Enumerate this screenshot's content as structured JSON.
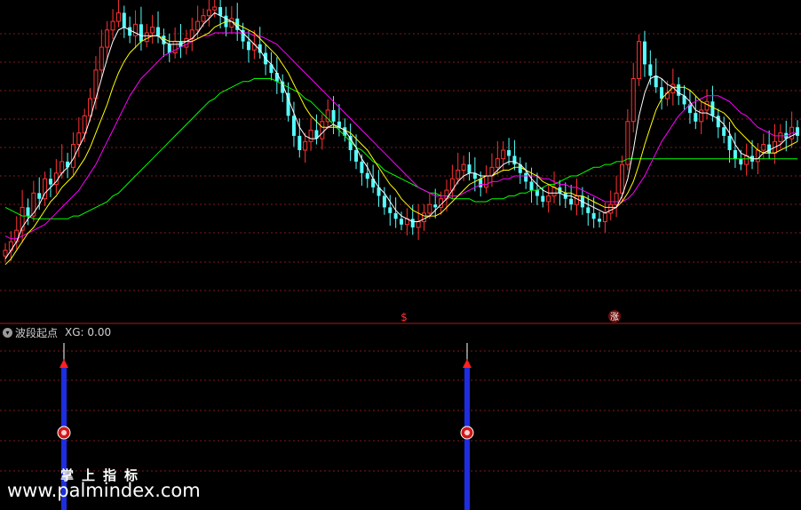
{
  "indicator": {
    "name": "波段起点",
    "value_label": "XG: 0.00",
    "toggle_icon": "chevron-down-icon"
  },
  "markers": {
    "sell_label": "$",
    "rise_label": "涨"
  },
  "watermark": {
    "chinese": "掌上指标",
    "url": "www.palmindex.com"
  },
  "colors": {
    "background": "#000000",
    "up_candle": "#ff3232",
    "down_candle": "#54ffff",
    "ma_fast": "#ffffff",
    "ma_mid": "#ffff00",
    "ma_slow": "#ff00ff",
    "ma_long": "#00ff00",
    "grid": "#7a1c1c",
    "divider": "#b01818",
    "signal_bar": "#1e2de0",
    "signal_arrow": "#ff2020"
  },
  "chart_data": {
    "type": "candlestick",
    "title": "",
    "xlabel": "",
    "ylabel": "",
    "series_main": {
      "close": [
        0.15,
        0.18,
        0.22,
        0.3,
        0.27,
        0.35,
        0.33,
        0.4,
        0.38,
        0.42,
        0.46,
        0.44,
        0.52,
        0.56,
        0.62,
        0.68,
        0.78,
        0.86,
        0.92,
        0.95,
        0.98,
        0.93,
        0.9,
        0.94,
        0.88,
        0.91,
        0.93,
        0.9,
        0.87,
        0.84,
        0.88,
        0.86,
        0.89,
        0.92,
        0.95,
        0.97,
        0.99,
        1.0,
        0.97,
        0.93,
        0.96,
        0.92,
        0.88,
        0.85,
        0.87,
        0.84,
        0.8,
        0.77,
        0.74,
        0.7,
        0.62,
        0.55,
        0.5,
        0.53,
        0.57,
        0.54,
        0.6,
        0.64,
        0.6,
        0.58,
        0.55,
        0.5,
        0.46,
        0.42,
        0.4,
        0.37,
        0.34,
        0.3,
        0.28,
        0.26,
        0.24,
        0.26,
        0.23,
        0.25,
        0.28,
        0.31,
        0.3,
        0.33,
        0.36,
        0.4,
        0.43,
        0.45,
        0.42,
        0.4,
        0.37,
        0.41,
        0.44,
        0.47,
        0.5,
        0.48,
        0.45,
        0.42,
        0.39,
        0.36,
        0.34,
        0.32,
        0.34,
        0.37,
        0.35,
        0.33,
        0.31,
        0.34,
        0.3,
        0.28,
        0.26,
        0.25,
        0.28,
        0.31,
        0.35,
        0.45,
        0.6,
        0.75,
        0.88,
        0.8,
        0.76,
        0.72,
        0.68,
        0.7,
        0.73,
        0.69,
        0.66,
        0.63,
        0.6,
        0.64,
        0.67,
        0.62,
        0.58,
        0.55,
        0.5,
        0.47,
        0.45,
        0.48,
        0.46,
        0.5,
        0.52,
        0.49,
        0.53,
        0.56,
        0.54,
        0.58,
        0.55
      ],
      "ma5": [
        0.12,
        0.15,
        0.18,
        0.23,
        0.26,
        0.28,
        0.31,
        0.35,
        0.37,
        0.39,
        0.42,
        0.44,
        0.47,
        0.51,
        0.55,
        0.61,
        0.68,
        0.75,
        0.82,
        0.88,
        0.92,
        0.93,
        0.92,
        0.91,
        0.9,
        0.9,
        0.9,
        0.9,
        0.88,
        0.87,
        0.87,
        0.87,
        0.88,
        0.89,
        0.91,
        0.94,
        0.96,
        0.98,
        0.97,
        0.96,
        0.95,
        0.93,
        0.91,
        0.89,
        0.87,
        0.85,
        0.82,
        0.8,
        0.77,
        0.73,
        0.68,
        0.63,
        0.58,
        0.55,
        0.54,
        0.54,
        0.56,
        0.58,
        0.59,
        0.58,
        0.57,
        0.54,
        0.51,
        0.47,
        0.44,
        0.4,
        0.37,
        0.35,
        0.32,
        0.29,
        0.27,
        0.26,
        0.25,
        0.25,
        0.26,
        0.27,
        0.29,
        0.31,
        0.33,
        0.36,
        0.39,
        0.41,
        0.42,
        0.42,
        0.41,
        0.41,
        0.41,
        0.43,
        0.45,
        0.46,
        0.46,
        0.45,
        0.43,
        0.4,
        0.38,
        0.36,
        0.35,
        0.35,
        0.35,
        0.34,
        0.34,
        0.33,
        0.32,
        0.31,
        0.3,
        0.29,
        0.28,
        0.29,
        0.3,
        0.34,
        0.4,
        0.5,
        0.62,
        0.7,
        0.75,
        0.76,
        0.75,
        0.73,
        0.72,
        0.7,
        0.69,
        0.67,
        0.64,
        0.63,
        0.63,
        0.62,
        0.61,
        0.59,
        0.56,
        0.52,
        0.49,
        0.48,
        0.47,
        0.47,
        0.49,
        0.5,
        0.51,
        0.52,
        0.54,
        0.55,
        0.56
      ],
      "ma10": [
        0.1,
        0.12,
        0.15,
        0.18,
        0.21,
        0.23,
        0.26,
        0.29,
        0.32,
        0.34,
        0.37,
        0.39,
        0.41,
        0.44,
        0.47,
        0.51,
        0.56,
        0.61,
        0.66,
        0.72,
        0.77,
        0.81,
        0.84,
        0.86,
        0.88,
        0.89,
        0.9,
        0.9,
        0.89,
        0.88,
        0.88,
        0.88,
        0.88,
        0.88,
        0.89,
        0.9,
        0.91,
        0.93,
        0.94,
        0.95,
        0.95,
        0.94,
        0.93,
        0.92,
        0.91,
        0.89,
        0.87,
        0.85,
        0.83,
        0.8,
        0.77,
        0.73,
        0.69,
        0.65,
        0.62,
        0.6,
        0.58,
        0.58,
        0.58,
        0.58,
        0.57,
        0.56,
        0.54,
        0.52,
        0.5,
        0.47,
        0.44,
        0.41,
        0.38,
        0.36,
        0.33,
        0.31,
        0.29,
        0.28,
        0.27,
        0.27,
        0.27,
        0.28,
        0.3,
        0.32,
        0.34,
        0.36,
        0.38,
        0.39,
        0.4,
        0.41,
        0.41,
        0.42,
        0.43,
        0.43,
        0.44,
        0.44,
        0.43,
        0.42,
        0.41,
        0.39,
        0.38,
        0.37,
        0.36,
        0.35,
        0.35,
        0.34,
        0.34,
        0.33,
        0.32,
        0.31,
        0.3,
        0.3,
        0.3,
        0.32,
        0.35,
        0.39,
        0.45,
        0.52,
        0.58,
        0.64,
        0.68,
        0.7,
        0.72,
        0.72,
        0.72,
        0.71,
        0.69,
        0.67,
        0.66,
        0.65,
        0.64,
        0.63,
        0.61,
        0.58,
        0.56,
        0.54,
        0.52,
        0.5,
        0.49,
        0.49,
        0.49,
        0.5,
        0.51,
        0.52,
        0.53
      ],
      "ma20": [
        0.2,
        0.19,
        0.19,
        0.2,
        0.21,
        0.22,
        0.23,
        0.24,
        0.26,
        0.28,
        0.3,
        0.32,
        0.34,
        0.36,
        0.39,
        0.42,
        0.45,
        0.49,
        0.53,
        0.57,
        0.61,
        0.65,
        0.69,
        0.72,
        0.75,
        0.77,
        0.79,
        0.81,
        0.83,
        0.84,
        0.85,
        0.86,
        0.87,
        0.88,
        0.89,
        0.9,
        0.9,
        0.91,
        0.91,
        0.91,
        0.91,
        0.91,
        0.91,
        0.91,
        0.9,
        0.9,
        0.89,
        0.88,
        0.87,
        0.85,
        0.83,
        0.81,
        0.79,
        0.77,
        0.75,
        0.73,
        0.71,
        0.69,
        0.67,
        0.65,
        0.63,
        0.61,
        0.59,
        0.57,
        0.55,
        0.53,
        0.51,
        0.49,
        0.47,
        0.45,
        0.43,
        0.41,
        0.39,
        0.37,
        0.36,
        0.35,
        0.34,
        0.34,
        0.34,
        0.34,
        0.34,
        0.35,
        0.36,
        0.37,
        0.38,
        0.38,
        0.39,
        0.39,
        0.4,
        0.4,
        0.41,
        0.41,
        0.41,
        0.41,
        0.41,
        0.4,
        0.4,
        0.39,
        0.38,
        0.38,
        0.37,
        0.37,
        0.36,
        0.35,
        0.34,
        0.33,
        0.32,
        0.32,
        0.32,
        0.32,
        0.33,
        0.35,
        0.38,
        0.41,
        0.45,
        0.49,
        0.53,
        0.56,
        0.59,
        0.62,
        0.64,
        0.66,
        0.67,
        0.68,
        0.69,
        0.69,
        0.69,
        0.68,
        0.67,
        0.65,
        0.63,
        0.62,
        0.6,
        0.58,
        0.57,
        0.56,
        0.55,
        0.55,
        0.55,
        0.56,
        0.56
      ],
      "ma60": [
        0.3,
        0.29,
        0.28,
        0.27,
        0.27,
        0.26,
        0.26,
        0.26,
        0.26,
        0.26,
        0.26,
        0.26,
        0.27,
        0.27,
        0.28,
        0.29,
        0.3,
        0.31,
        0.32,
        0.34,
        0.35,
        0.37,
        0.39,
        0.41,
        0.43,
        0.45,
        0.47,
        0.49,
        0.51,
        0.53,
        0.55,
        0.57,
        0.59,
        0.61,
        0.63,
        0.65,
        0.67,
        0.68,
        0.7,
        0.71,
        0.72,
        0.73,
        0.74,
        0.74,
        0.75,
        0.75,
        0.75,
        0.75,
        0.74,
        0.73,
        0.72,
        0.71,
        0.7,
        0.68,
        0.67,
        0.65,
        0.63,
        0.61,
        0.59,
        0.57,
        0.55,
        0.53,
        0.51,
        0.5,
        0.48,
        0.46,
        0.45,
        0.43,
        0.42,
        0.41,
        0.4,
        0.39,
        0.38,
        0.37,
        0.36,
        0.35,
        0.35,
        0.34,
        0.34,
        0.33,
        0.33,
        0.33,
        0.33,
        0.32,
        0.32,
        0.32,
        0.33,
        0.33,
        0.33,
        0.34,
        0.34,
        0.35,
        0.35,
        0.36,
        0.36,
        0.37,
        0.38,
        0.38,
        0.39,
        0.4,
        0.41,
        0.41,
        0.42,
        0.43,
        0.44,
        0.44,
        0.45,
        0.45,
        0.46,
        0.46,
        0.47,
        0.47,
        0.47,
        0.47,
        0.47,
        0.47,
        0.47,
        0.47,
        0.47,
        0.47,
        0.47,
        0.47,
        0.47,
        0.47,
        0.47,
        0.47,
        0.47,
        0.47,
        0.47,
        0.47,
        0.47,
        0.47,
        0.47,
        0.47,
        0.47,
        0.47,
        0.47,
        0.47,
        0.47,
        0.47,
        0.47
      ]
    },
    "signals": [
      {
        "index": 16,
        "label": "XG"
      },
      {
        "index": 120,
        "label": "XG"
      }
    ],
    "signal_candle_indices": {
      "sell": 106,
      "rise": 163
    }
  }
}
